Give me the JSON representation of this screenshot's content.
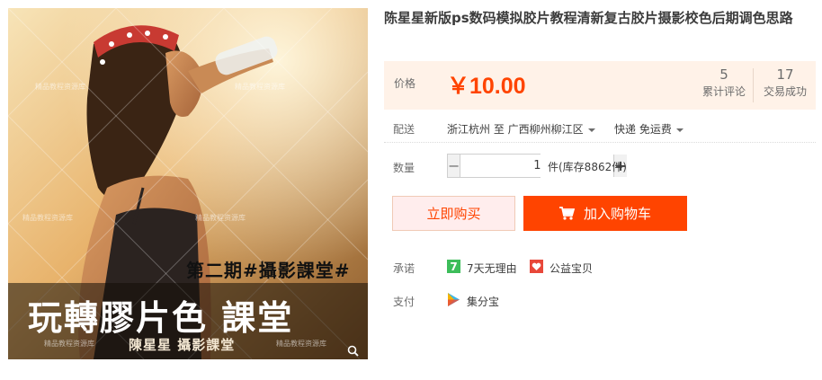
{
  "product_image": {
    "series_line": "第二期#攝影課堂#",
    "main_title": "玩轉膠片色 課堂",
    "author_line": "陳星星 攝影課堂",
    "watermark": "精品教程资源库"
  },
  "title": "陈星星新版ps数码模拟胶片教程清新复古胶片摄影校色后期调色思路",
  "price": {
    "label": "价格",
    "value": "￥10.00"
  },
  "stats": [
    {
      "count": "5",
      "label": "累计评论"
    },
    {
      "count": "17",
      "label": "交易成功"
    }
  ],
  "shipping": {
    "label": "配送",
    "route": "浙江杭州 至  广西柳州柳江区",
    "method": "快递 免运费"
  },
  "quantity": {
    "label": "数量",
    "value": "1",
    "minus": "−",
    "plus": "+",
    "stock_text": "件(库存8862件)"
  },
  "actions": {
    "buy_now": "立即购买",
    "add_to_cart": "加入购物车"
  },
  "promise": {
    "label": "承诺",
    "items": [
      {
        "icon": "seven-day-return-icon",
        "text": "7天无理由"
      },
      {
        "icon": "charity-icon",
        "text": "公益宝贝"
      }
    ]
  },
  "payment": {
    "label": "支付",
    "items": [
      {
        "icon": "jifenbao-icon",
        "text": "集分宝"
      }
    ]
  },
  "colors": {
    "accent": "#ff4400",
    "price_bg": "#fff2e8",
    "buy_bg": "#ffeded"
  }
}
